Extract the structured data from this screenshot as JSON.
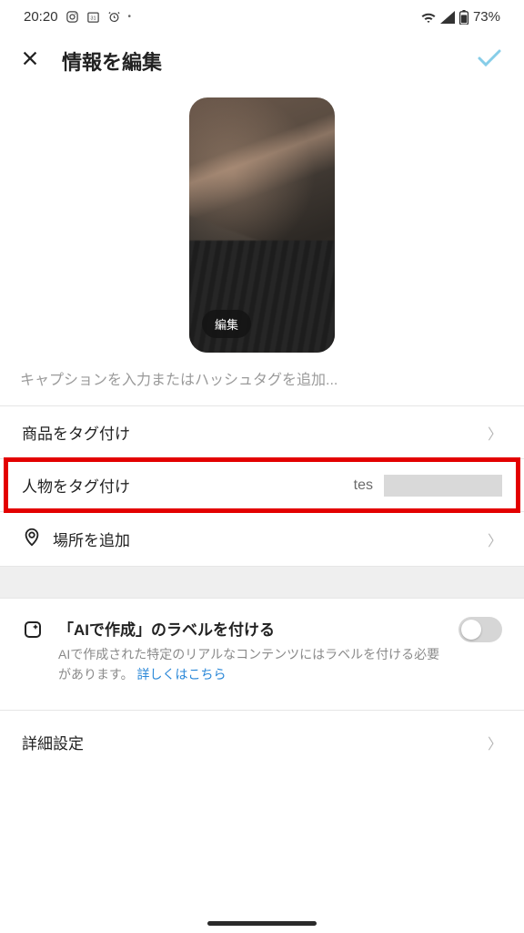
{
  "status": {
    "time": "20:20",
    "battery_label": "73%"
  },
  "header": {
    "title": "情報を編集"
  },
  "preview": {
    "edit_label": "編集"
  },
  "caption": {
    "placeholder": "キャプションを入力またはハッシュタグを追加..."
  },
  "rows": {
    "tag_product": {
      "label": "商品をタグ付け"
    },
    "tag_person": {
      "label": "人物をタグ付け",
      "value": "tes"
    },
    "add_location": {
      "label": "場所を追加"
    }
  },
  "ai": {
    "title": "「AIで作成」のラベルを付ける",
    "desc_a": "AIで作成された特定のリアルなコンテンツにはラベルを付ける必要があります。",
    "link": "詳しくはこちら"
  },
  "advanced": {
    "label": "詳細設定"
  }
}
